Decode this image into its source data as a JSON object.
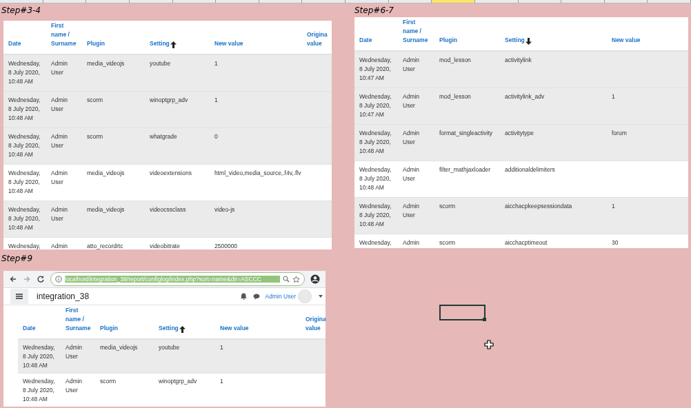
{
  "sheet": {
    "column_headers": [
      {
        "selected": false
      },
      {
        "selected": false
      },
      {
        "selected": false
      },
      {
        "selected": false
      },
      {
        "selected": false
      },
      {
        "selected": false
      },
      {
        "selected": false
      },
      {
        "selected": false
      },
      {
        "selected": false
      },
      {
        "selected": false
      },
      {
        "selected": true
      },
      {
        "selected": false
      },
      {
        "selected": false
      },
      {
        "selected": false
      },
      {
        "selected": false
      },
      {
        "selected": false
      }
    ]
  },
  "panels": [
    {
      "caption": "Step#3-4",
      "columns": [
        {
          "label": "Date",
          "sorted": false
        },
        {
          "label": "First name / Surname",
          "sorted": false
        },
        {
          "label": "Plugin",
          "sorted": false
        },
        {
          "label": "Setting",
          "sorted": true,
          "descending": false
        },
        {
          "label": "New value",
          "sorted": false
        },
        {
          "label": "Origina value"
        }
      ],
      "rows": [
        {
          "shaded": true,
          "cells": [
            "Wednesday, 8 July 2020, 10:48 AM",
            "Admin User",
            "media_videojs",
            "youtube",
            "1"
          ]
        },
        {
          "shaded": true,
          "cells": [
            "Wednesday, 8 July 2020, 10:48 AM",
            "Admin User",
            "scorm",
            "winoptgrp_adv",
            "1"
          ]
        },
        {
          "shaded": true,
          "cells": [
            "Wednesday, 8 July 2020, 10:48 AM",
            "Admin User",
            "scorm",
            "whatgrade",
            "0"
          ]
        },
        {
          "shaded": false,
          "cells": [
            "Wednesday, 8 July 2020, 10:48 AM",
            "Admin User",
            "media_videojs",
            "videoextensions",
            "html_video,media_source,.f4v,.flv"
          ]
        },
        {
          "shaded": true,
          "cells": [
            "Wednesday, 8 July 2020, 10:48 AM",
            "Admin User",
            "media_videojs",
            "videocssclass",
            "video-js"
          ]
        },
        {
          "shaded": false,
          "cells": [
            "Wednesday,",
            "Admin",
            "atto_recordrtc",
            "videobitrate",
            "2500000"
          ]
        }
      ]
    },
    {
      "caption": "Step#6-7",
      "columns": [
        {
          "label": "Date",
          "sorted": false
        },
        {
          "label": "First name / Surname",
          "sorted": false
        },
        {
          "label": "Plugin",
          "sorted": false
        },
        {
          "label": "Setting",
          "sorted": true,
          "descending": true
        },
        {
          "label": "New value",
          "sorted": false
        }
      ],
      "rows": [
        {
          "shaded": true,
          "cells": [
            "Wednesday, 8 July 2020, 10:47 AM",
            "Admin User",
            "mod_lesson",
            "activitylink",
            ""
          ]
        },
        {
          "shaded": true,
          "cells": [
            "Wednesday, 8 July 2020, 10:47 AM",
            "Admin User",
            "mod_lesson",
            "activitylink_adv",
            "1"
          ]
        },
        {
          "shaded": true,
          "cells": [
            "Wednesday, 8 July 2020, 10:48 AM",
            "Admin User",
            "format_singleactivity",
            "activitytype",
            "forum"
          ]
        },
        {
          "shaded": false,
          "cells": [
            "Wednesday, 8 July 2020, 10:48 AM",
            "Admin User",
            "filter_mathjaxloader",
            "additionaldelimiters",
            ""
          ]
        },
        {
          "shaded": true,
          "cells": [
            "Wednesday, 8 July 2020, 10:48 AM",
            "Admin User",
            "scorm",
            "aicchacpkeepsessiondata",
            "1"
          ]
        },
        {
          "shaded": false,
          "cells": [
            "Wednesday,",
            "Admin",
            "scorm",
            "aicchacptimeout",
            "30"
          ]
        }
      ]
    }
  ],
  "browser": {
    "caption": "Step#9",
    "url": "localhost/integration_38/report/configlog/index.php?sort=name&dir=ASCCC",
    "site_name": "integration_38",
    "user_name": "Admin User",
    "columns": [
      {
        "label": "Date",
        "sorted": false
      },
      {
        "label": "First name / Surname",
        "sorted": false
      },
      {
        "label": "Plugin",
        "sorted": false
      },
      {
        "label": "Setting",
        "sorted": true,
        "descending": false
      },
      {
        "label": "New value",
        "sorted": false
      },
      {
        "label": "Origina value"
      }
    ],
    "rows": [
      {
        "shaded": true,
        "cells": [
          "Wednesday, 8 July 2020, 10:48 AM",
          "Admin User",
          "media_videojs",
          "youtube",
          "1"
        ]
      },
      {
        "shaded": false,
        "cells": [
          "Wednesday, 8 July 2020, 10:48 AM",
          "Admin User",
          "scorm",
          "winoptgrp_adv",
          "1"
        ]
      }
    ]
  }
}
